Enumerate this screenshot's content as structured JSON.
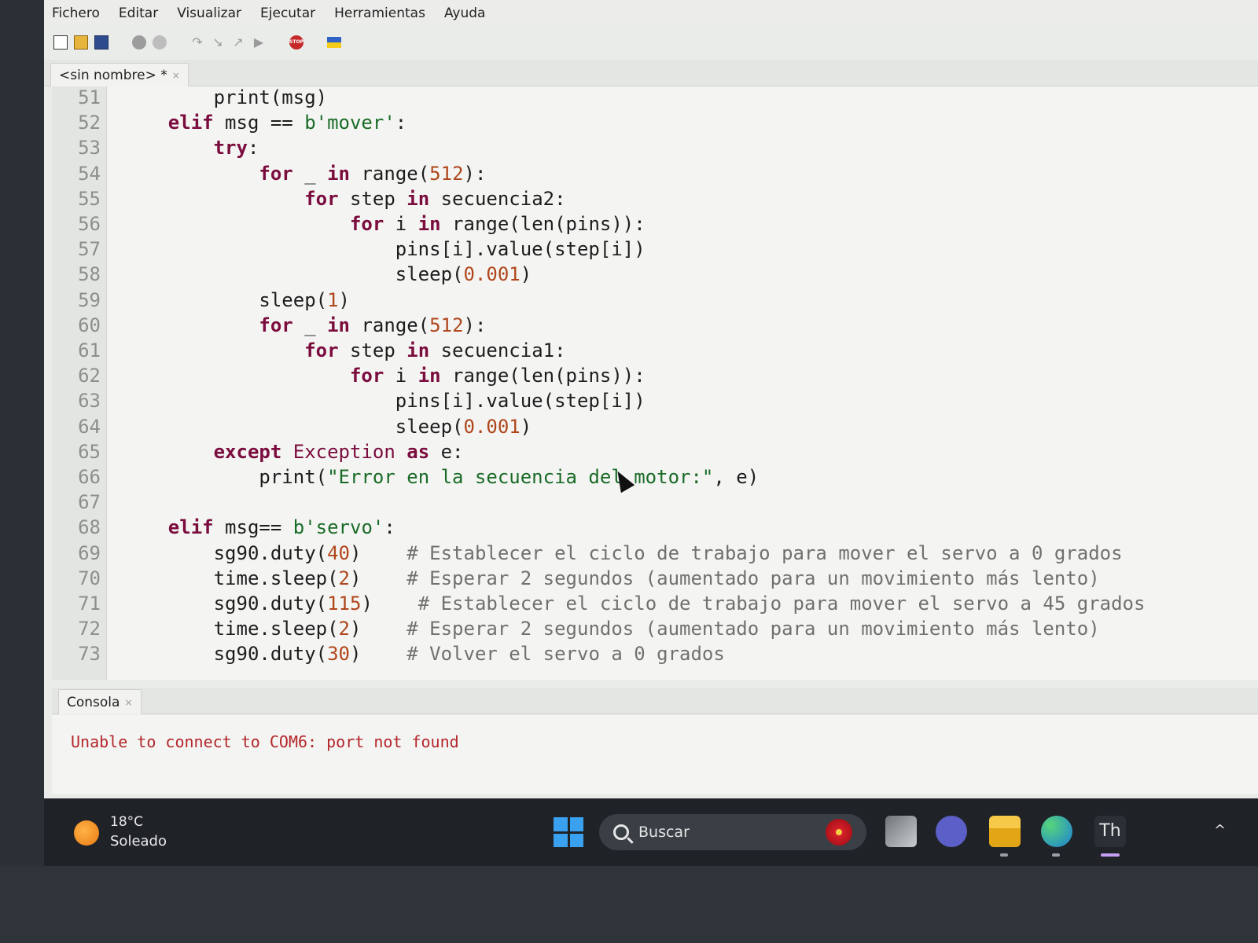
{
  "menu": [
    "Fichero",
    "Editar",
    "Visualizar",
    "Ejecutar",
    "Herramientas",
    "Ayuda"
  ],
  "toolbar": {
    "icons": [
      "new-file-icon",
      "open-file-icon",
      "save-icon",
      "run-icon",
      "debug-icon",
      "step-over-icon",
      "step-into-icon",
      "step-out-icon",
      "resume-icon",
      "stop-icon",
      "flag-icon"
    ],
    "stop_label": "STOP"
  },
  "editor": {
    "tab_title": "<sin nombre> *",
    "tab_close": "×",
    "lines": [
      {
        "n": "51",
        "code": "        print(msg)"
      },
      {
        "n": "52",
        "code": "    elif msg == b'mover':"
      },
      {
        "n": "53",
        "code": "        try:"
      },
      {
        "n": "54",
        "code": "            for _ in range(512):"
      },
      {
        "n": "55",
        "code": "                for step in secuencia2:"
      },
      {
        "n": "56",
        "code": "                    for i in range(len(pins)):"
      },
      {
        "n": "57",
        "code": "                        pins[i].value(step[i])"
      },
      {
        "n": "58",
        "code": "                        sleep(0.001)"
      },
      {
        "n": "59",
        "code": "            sleep(1)"
      },
      {
        "n": "60",
        "code": "            for _ in range(512):"
      },
      {
        "n": "61",
        "code": "                for step in secuencia1:"
      },
      {
        "n": "62",
        "code": "                    for i in range(len(pins)):"
      },
      {
        "n": "63",
        "code": "                        pins[i].value(step[i])"
      },
      {
        "n": "64",
        "code": "                        sleep(0.001)"
      },
      {
        "n": "65",
        "code": "        except Exception as e:"
      },
      {
        "n": "66",
        "code": "            print(\"Error en la secuencia del motor:\", e)"
      },
      {
        "n": "67",
        "code": ""
      },
      {
        "n": "68",
        "code": "    elif msg== b'servo':"
      },
      {
        "n": "69",
        "code": "        sg90.duty(40)    # Establecer el ciclo de trabajo para mover el servo a 0 grados"
      },
      {
        "n": "70",
        "code": "        time.sleep(2)    # Esperar 2 segundos (aumentado para un movimiento más lento)"
      },
      {
        "n": "71",
        "code": "        sg90.duty(115)    # Establecer el ciclo de trabajo para mover el servo a 45 grados"
      },
      {
        "n": "72",
        "code": "        time.sleep(2)    # Esperar 2 segundos (aumentado para un movimiento más lento)"
      },
      {
        "n": "73",
        "code": "        sg90.duty(30)    # Volver el servo a 0 grados"
      }
    ]
  },
  "console": {
    "tab_title": "Consola",
    "tab_close": "×",
    "message": "Unable to connect to COM6: port not found"
  },
  "taskbar": {
    "weather_temp": "18°C",
    "weather_desc": "Soleado",
    "search_placeholder": "Buscar",
    "thonny_label": "Th",
    "chevron": "^"
  }
}
